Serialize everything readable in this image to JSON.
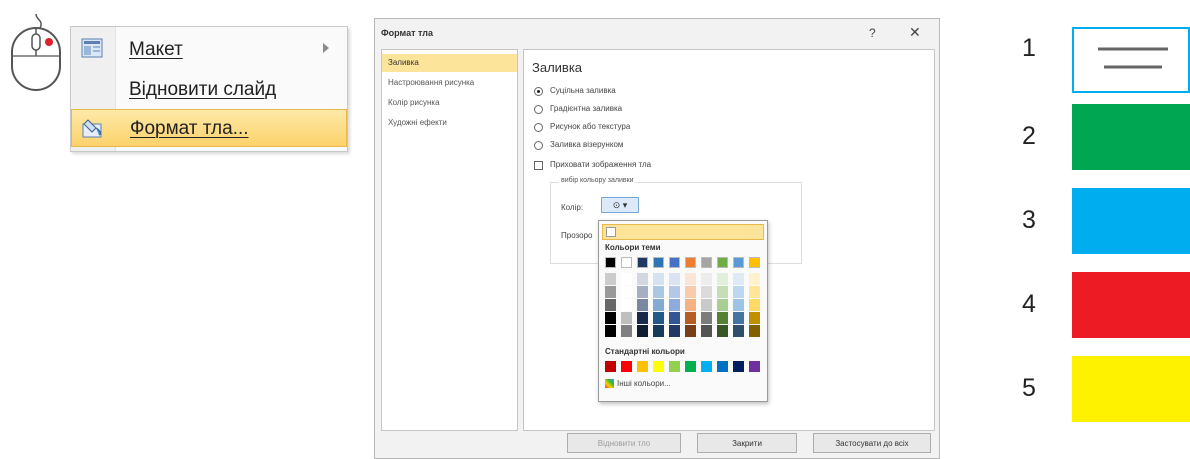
{
  "context_menu": {
    "items": [
      {
        "label": "Макет",
        "icon": "layout-icon",
        "has_submenu": true
      },
      {
        "label": "Відновити слайд",
        "icon": "",
        "has_submenu": false
      },
      {
        "label": "Формат тла...",
        "icon": "format-background-icon",
        "has_submenu": false,
        "highlighted": true
      }
    ]
  },
  "dialog": {
    "title": "Формат тла",
    "help": "?",
    "close": "✕",
    "nav": [
      {
        "label": "Заливка",
        "selected": true
      },
      {
        "label": "Настроювання рисунка",
        "selected": false
      },
      {
        "label": "Колір рисунка",
        "selected": false
      },
      {
        "label": "Художні ефекти",
        "selected": false
      }
    ],
    "section_title": "Заливка",
    "fill_options": [
      {
        "label": "Суцільна заливка",
        "checked": true
      },
      {
        "label": "Градієнтна заливка",
        "checked": false
      },
      {
        "label": "Рисунок або текстура",
        "checked": false
      },
      {
        "label": "Заливка візерунком",
        "checked": false
      }
    ],
    "hide_background_label": "Приховати зображення тла",
    "group_label": "вибір кольору заливки",
    "color_label": "Колір:",
    "transparency_label": "Прозоро",
    "buttons": {
      "reset": "Відновити тло",
      "close": "Закрити",
      "apply_all": "Застосувати до всіх"
    }
  },
  "palette": {
    "auto_label": "Автоматичний",
    "theme_title": "Кольори теми",
    "standard_title": "Стандартні кольори",
    "more_colors": "Інші кольори...",
    "theme_top": [
      "#000000",
      "#ffffff",
      "#1f3864",
      "#2e75b6",
      "#4472c4",
      "#ed7d31",
      "#a5a5a5",
      "#70ad47",
      "#5b9bd5",
      "#ffc000"
    ],
    "standard": [
      "#c00000",
      "#ff0000",
      "#ffc000",
      "#ffff00",
      "#92d050",
      "#00b050",
      "#00b0f0",
      "#0070c0",
      "#002060",
      "#7030a0"
    ]
  },
  "legend": [
    {
      "number": "1",
      "color": "#ffffff",
      "kind": "menu-lines"
    },
    {
      "number": "2",
      "color": "#00a651",
      "kind": "swatch"
    },
    {
      "number": "3",
      "color": "#00aeef",
      "kind": "swatch"
    },
    {
      "number": "4",
      "color": "#ed1c24",
      "kind": "swatch"
    },
    {
      "number": "5",
      "color": "#fff200",
      "kind": "swatch"
    }
  ],
  "colors": {
    "legend_border": "#00aeef"
  }
}
